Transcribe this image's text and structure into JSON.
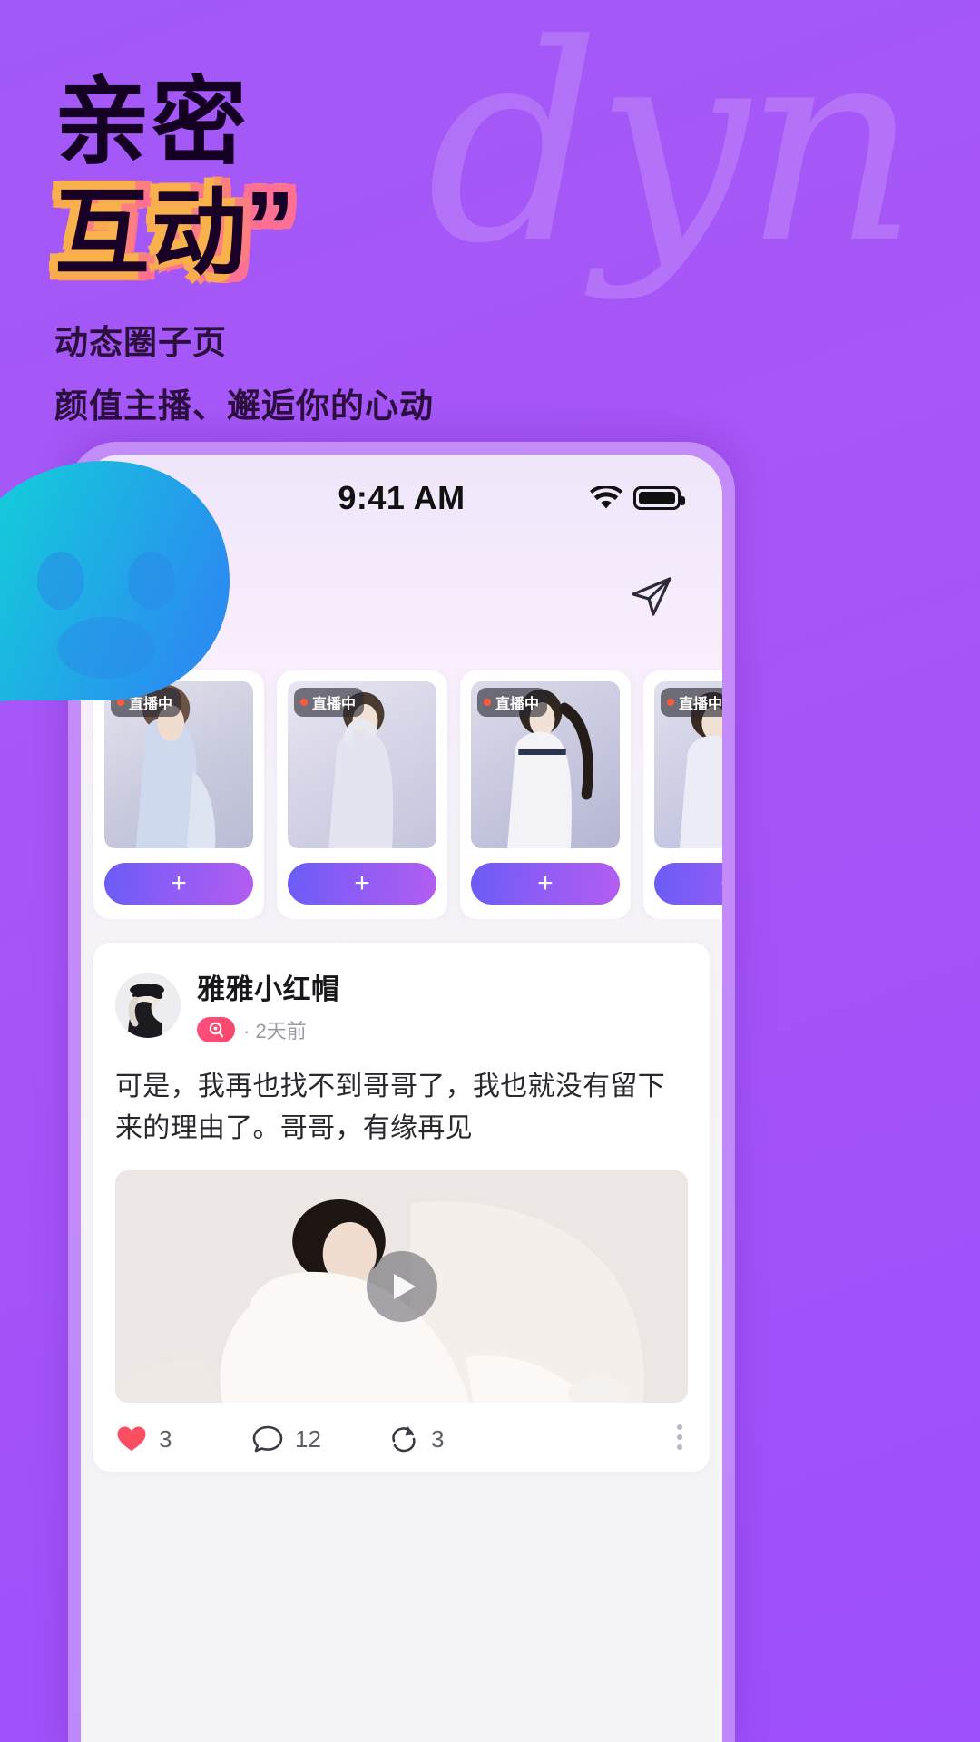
{
  "promo": {
    "script_watermark": "dyn",
    "headline_line1": "亲密",
    "headline_line2": "互动",
    "headline_quote": "”",
    "subtitle_line1": "动态圈子页",
    "subtitle_line2": "颜值主播、邂逅你的心动",
    "bg_color": "#a855f7",
    "headline_dark_color": "#150024",
    "headline_gradient_from": "#f9b04c",
    "headline_gradient_to": "#fd6f93"
  },
  "decor": {
    "sparkle_small": "sparkle-icon",
    "sparkle_large": "sparkle-icon",
    "sparkle_color_from": "#4de2f0",
    "sparkle_color_to": "#1f7fe8",
    "blob": "speech-bubble-face",
    "blob_color_from": "#12d8d8",
    "blob_color_to": "#2a8ef0"
  },
  "phone": {
    "statusbar": {
      "time": "9:41 AM",
      "signal_icon": "cellular-signal-icon",
      "wifi_icon": "wifi-icon",
      "battery_icon": "battery-icon"
    },
    "nav": {
      "send_icon": "send-plane-icon"
    },
    "live_section": {
      "cards": [
        {
          "badge": "直播中",
          "follow": "+",
          "img_from": "#d8d9e4",
          "img_to": "#c8cbdd"
        },
        {
          "badge": "直播中",
          "follow": "+",
          "img_from": "#dcdbe9",
          "img_to": "#cfcee2"
        },
        {
          "badge": "直播中",
          "follow": "+",
          "img_from": "#d5d4e6",
          "img_to": "#c2c3dc"
        },
        {
          "badge": "直播中",
          "follow": "+",
          "img_from": "#dad9ea",
          "img_to": "#c9c8e0"
        }
      ]
    },
    "post": {
      "author": "雅雅小红帽",
      "badge_icon": "live-mic-badge-icon",
      "time": "· 2天前",
      "text": "可是，我再也找不到哥哥了，我也就没有留下来的理由了。哥哥，有缘再见",
      "media_play_icon": "play-icon",
      "actions": {
        "like_icon": "heart-icon",
        "like_count": "3",
        "comment_icon": "comment-icon",
        "comment_count": "12",
        "share_icon": "repost-icon",
        "share_count": "3",
        "more_icon": "more-vertical-icon"
      },
      "like_color": "#fb4e63",
      "accent": "#8b5cf6"
    }
  }
}
